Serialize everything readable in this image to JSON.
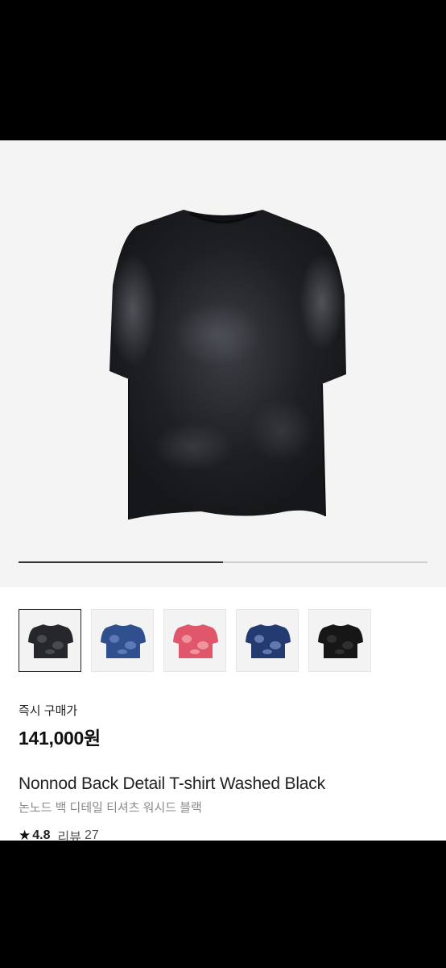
{
  "product": {
    "gallery": {
      "progress_fraction": 0.5,
      "thumbnails": [
        {
          "name": "thumb-black-washed",
          "shirt_color": "#26272b",
          "accent": "#555a62",
          "active": true
        },
        {
          "name": "thumb-blue-washed",
          "shirt_color": "#2f4f8f",
          "accent": "#6f8dc6",
          "active": false
        },
        {
          "name": "thumb-pink-washed",
          "shirt_color": "#e0566a",
          "accent": "#f4b0b8",
          "active": false
        },
        {
          "name": "thumb-navy-washed",
          "shirt_color": "#243b72",
          "accent": "#7d93c7",
          "active": false
        },
        {
          "name": "thumb-black-solid",
          "shirt_color": "#161616",
          "accent": "#3a3a3a",
          "active": false
        }
      ]
    },
    "price_label": "즉시 구매가",
    "price": "141,000원",
    "name_en": "Nonnod Back Detail T-shirt Washed Black",
    "name_ko": "논노드 백 디테일 티셔츠 워시드 블랙",
    "rating": "4.8",
    "review_label": "리뷰",
    "review_count": "27",
    "icons": {
      "star": "star-icon"
    },
    "colors": {
      "accent": "#111111",
      "muted": "#8a8a8a"
    }
  }
}
